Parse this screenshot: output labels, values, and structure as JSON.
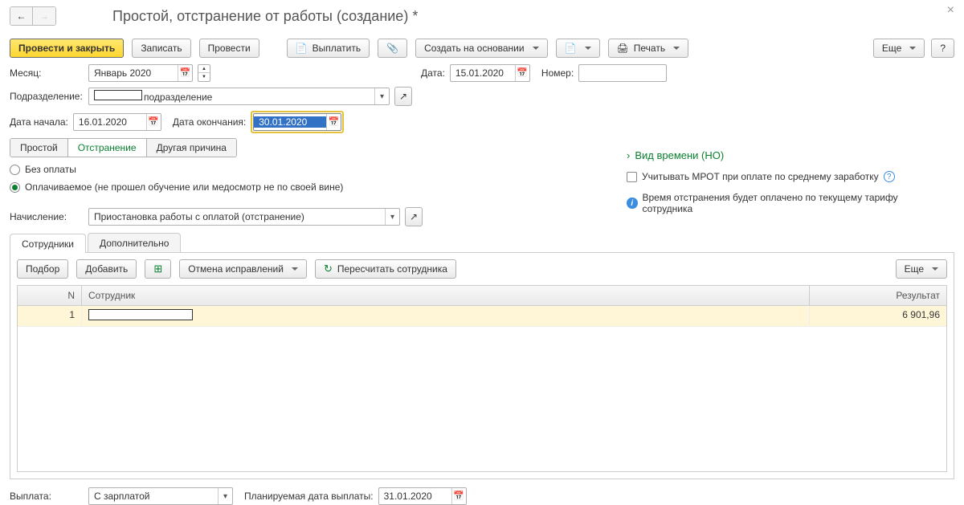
{
  "title": "Простой, отстранение от работы (создание) *",
  "toolbar": {
    "primary": "Провести и закрыть",
    "write": "Записать",
    "post": "Провести",
    "pay": "Выплатить",
    "create_based": "Создать на основании",
    "print": "Печать",
    "more": "Еще",
    "help": "?"
  },
  "fields": {
    "month_label": "Месяц:",
    "month_value": "Январь 2020",
    "date_label": "Дата:",
    "date_value": "15.01.2020",
    "number_label": "Номер:",
    "number_value": "",
    "dept_label": "Подразделение:",
    "dept_value": "подразделение",
    "start_label": "Дата начала:",
    "start_value": "16.01.2020",
    "end_label": "Дата окончания:",
    "end_value": "30.01.2020",
    "accrual_label": "Начисление:",
    "accrual_value": "Приостановка работы с оплатой (отстранение)",
    "payout_label": "Выплата:",
    "payout_value": "С зарплатой",
    "planned_label": "Планируемая дата выплаты:",
    "planned_value": "31.01.2020"
  },
  "tabs_reason": {
    "t1": "Простой",
    "t2": "Отстранение",
    "t3": "Другая причина"
  },
  "radios": {
    "r1": "Без оплаты",
    "r2": "Оплачиваемое (не прошел обучение или медосмотр не по своей вине)"
  },
  "side": {
    "link": "Вид времени (НО)",
    "check": "Учитывать МРОТ при оплате по среднему заработку",
    "info": "Время отстранения будет оплачено по текущему тарифу сотрудника"
  },
  "inner_tabs": {
    "t1": "Сотрудники",
    "t2": "Дополнительно"
  },
  "sub_toolbar": {
    "select": "Подбор",
    "add": "Добавить",
    "cancel_fix": "Отмена исправлений",
    "recalc": "Пересчитать сотрудника",
    "more": "Еще"
  },
  "table": {
    "h_n": "N",
    "h_emp": "Сотрудник",
    "h_res": "Результат",
    "rows": [
      {
        "n": "1",
        "emp": "",
        "res": "6 901,96"
      }
    ]
  }
}
